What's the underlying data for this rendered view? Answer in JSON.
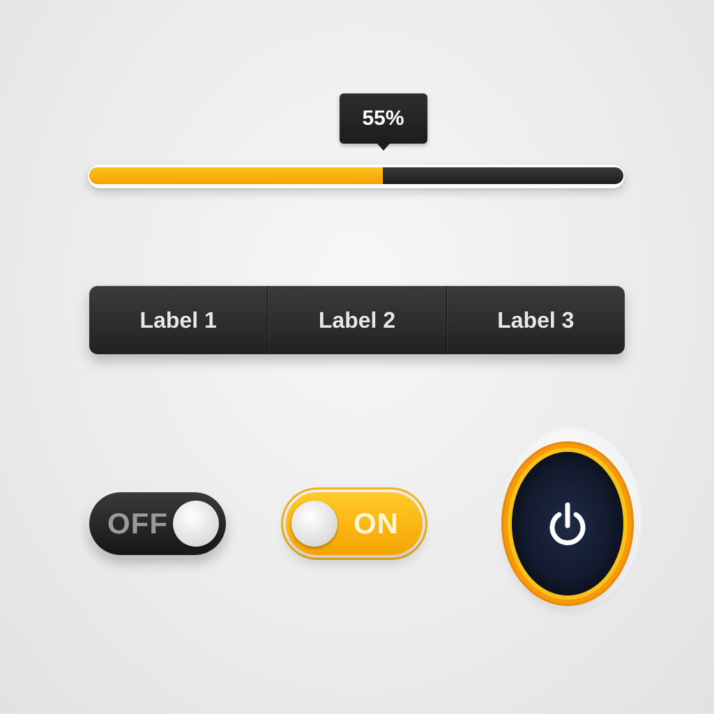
{
  "slider": {
    "value_percent": 55,
    "value_label": "55%",
    "fill_color": "#f6a100",
    "track_color": "#1f1f1f"
  },
  "segmented": {
    "items": [
      {
        "label": "Label 1"
      },
      {
        "label": "Label 2"
      },
      {
        "label": "Label 3"
      }
    ]
  },
  "toggles": {
    "off": {
      "label": "OFF",
      "state": "off"
    },
    "on": {
      "label": "ON",
      "state": "on",
      "color": "#f6a300"
    }
  },
  "power": {
    "icon": "power-icon",
    "ring_color": "#f59b0a"
  }
}
